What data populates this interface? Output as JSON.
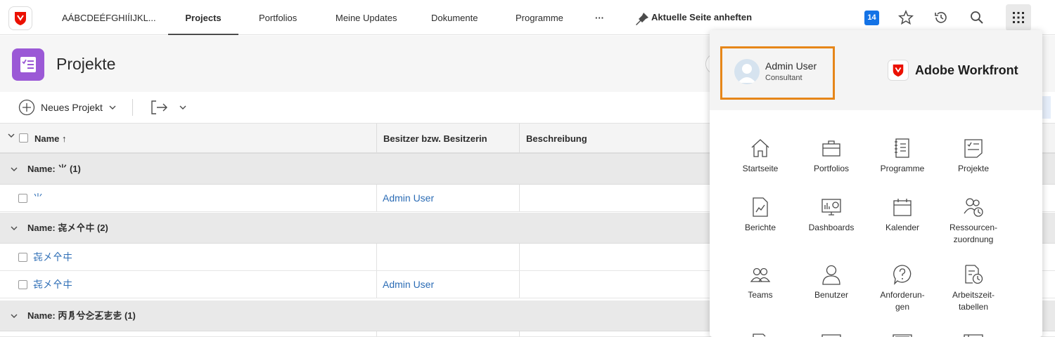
{
  "nav": {
    "workspace": "AÁBCDEÉFGHIÍIJKL...",
    "tabs": [
      "Projects",
      "Portfolios",
      "Meine Updates",
      "Dokumente",
      "Programme"
    ],
    "more": "···",
    "pin": "Aktuelle Seite anheften",
    "notification_count": "14"
  },
  "header": {
    "title": "Projekte"
  },
  "toolbar": {
    "new_project": "Neues Projekt"
  },
  "table": {
    "columns": [
      "Name ↑",
      "Besitzer bzw. Besitzerin",
      "Beschreibung"
    ],
    "groups": [
      {
        "label": "Name: ⺌ (1)",
        "rows": [
          {
            "name": "⺌",
            "owner": "Admin User"
          }
        ]
      },
      {
        "label": "Name: 㐂㐅㐃㐄 (2)",
        "rows": [
          {
            "name": "㐂㐅㐃㐄",
            "owner": ""
          },
          {
            "name": "㐂㐅㐃㐄",
            "owner": "Admin User"
          }
        ]
      },
      {
        "label": "Name: 丙㐆兮㐈㐉㐊㐋 (1)",
        "rows": []
      }
    ]
  },
  "panel": {
    "user_name": "Admin User",
    "user_role": "Consultant",
    "brand": "Adobe Workfront",
    "apps": [
      {
        "label": "Startseite",
        "icon": "home-icon"
      },
      {
        "label": "Portfolios",
        "icon": "briefcase-icon"
      },
      {
        "label": "Programme",
        "icon": "notebook-icon"
      },
      {
        "label": "Projekte",
        "icon": "project-icon"
      },
      {
        "label": "Berichte",
        "icon": "report-icon"
      },
      {
        "label": "Dashboards",
        "icon": "dashboard-icon"
      },
      {
        "label": "Kalender",
        "icon": "calendar-icon"
      },
      {
        "label": "Ressourcen-\nzuordnung",
        "icon": "resource-icon"
      },
      {
        "label": "Teams",
        "icon": "teams-icon"
      },
      {
        "label": "Benutzer",
        "icon": "user-icon"
      },
      {
        "label": "Anforderun-\ngen",
        "icon": "request-icon"
      },
      {
        "label": "Arbeitszeit-\ntabellen",
        "icon": "timesheet-icon"
      }
    ]
  },
  "colors": {
    "accent_blue": "#1473e6",
    "link_blue": "#2b6cb5",
    "project_purple": "#9b59d6",
    "highlight_orange": "#e68619",
    "brand_red": "#eb1000"
  }
}
